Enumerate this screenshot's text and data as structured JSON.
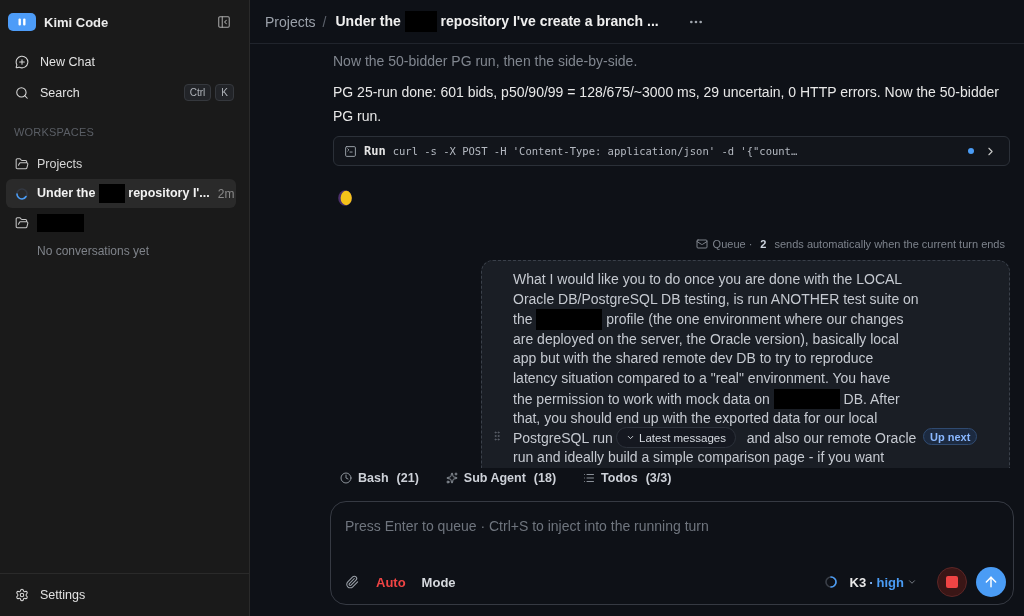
{
  "sidebar": {
    "brand": {
      "name": "Kimi Code"
    },
    "nav": [
      {
        "kind": "new-chat",
        "label": "New Chat"
      },
      {
        "kind": "search",
        "label": "Search",
        "shortcut": [
          "Ctrl",
          "K"
        ]
      }
    ],
    "section_title": "WORKSPACES",
    "workspaces": [
      {
        "name_parts": [
          {
            "kind": "text",
            "text": "Projects"
          }
        ],
        "conversations": [
          {
            "title_parts": [
              {
                "kind": "text",
                "text": "Under the "
              },
              {
                "kind": "redacted"
              },
              {
                "kind": "text",
                "text": " repository I'..."
              }
            ],
            "age": "2m",
            "selected": true,
            "running": true
          }
        ]
      },
      {
        "name_parts": [
          {
            "kind": "redacted"
          }
        ],
        "empty_note": "No conversations yet"
      }
    ],
    "footer": {
      "label": "Settings"
    }
  },
  "header": {
    "root": "Projects",
    "separator": "/",
    "title_parts": [
      {
        "kind": "text",
        "text": "Under the "
      },
      {
        "kind": "redacted"
      },
      {
        "kind": "text",
        "text": " repository I've create a branch ..."
      }
    ]
  },
  "messages": [
    {
      "kind": "status",
      "text": "Now the 50-bidder PG run, then the side-by-side."
    },
    {
      "kind": "reply",
      "text": "PG 25-run done: 601 bids, p50/90/99 = 128/675/~3000 ms, 29 uncertain, 0 HTTP errors. Now the 50-bidder PG run."
    },
    {
      "kind": "tool",
      "label": "Run",
      "command": "curl -s -X POST -H 'Content-Type: application/json' -d '{\"count…",
      "running": true
    },
    {
      "kind": "thinking"
    }
  ],
  "queue": {
    "label": "Queue ·",
    "count": "2",
    "note": "sends automatically when the current turn ends",
    "items": [
      {
        "badge": "Up next",
        "body_parts": [
          {
            "kind": "text",
            "text": "What I would like you to do once you are done with the LOCAL\nOracle DB/PostgreSQL DB testing, is run ANOTHER test suite on\nthe "
          },
          {
            "kind": "redacted"
          },
          {
            "kind": "text",
            "text": " profile (the one environment where our changes\nare deployed on the server, the Oracle version), basically local\napp but with the shared remote dev DB to try to reproduce\nlatency situation compared to a \"real\" environment. You have\nthe permission to work with mock data on "
          },
          {
            "kind": "redacted"
          },
          {
            "kind": "text",
            "text": " DB. After\nthat, you should end up with the exported data for our local\nPostgreSQL run "
          },
          {
            "kind": "covered"
          },
          {
            "kind": "text",
            "text": " and also our remote Oracle\nrun and ideally build a simple comparison page - if you want"
          }
        ]
      }
    ]
  },
  "jump_button": {
    "label": "Latest messages"
  },
  "activity": [
    {
      "kind": "bash",
      "label": "Bash",
      "count": "(21)"
    },
    {
      "kind": "sub-agent",
      "label": "Sub Agent",
      "count": "(18)"
    },
    {
      "kind": "todos",
      "label": "Todos",
      "count": "(3/3)"
    }
  ],
  "composer": {
    "placeholder": "Press Enter to queue · Ctrl+S to inject into the running turn",
    "busy": true,
    "modes": [
      {
        "label": "Auto",
        "highlighted": true
      },
      {
        "label": "Mode",
        "highlighted": false
      }
    ],
    "model": {
      "name": "K3",
      "separator": "·",
      "effort": "high"
    }
  }
}
